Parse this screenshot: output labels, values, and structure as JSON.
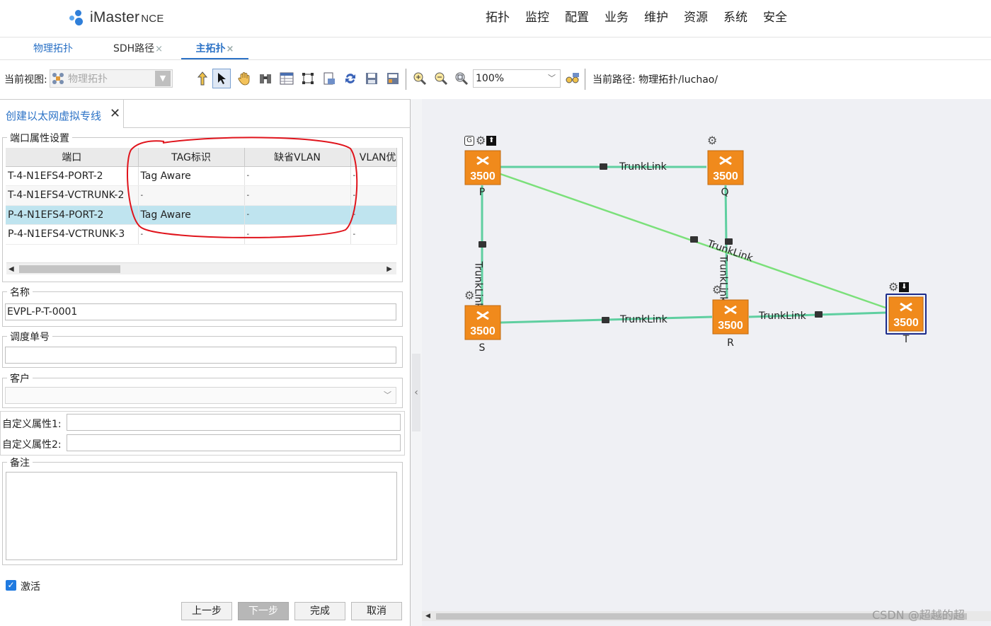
{
  "header": {
    "logo_text": "iMaster",
    "logo_suffix": "NCE",
    "menu": [
      "拓扑",
      "监控",
      "配置",
      "业务",
      "维护",
      "资源",
      "系统",
      "安全"
    ]
  },
  "tabs": [
    {
      "label": "物理拓扑",
      "closable": false
    },
    {
      "label": "SDH路径",
      "closable": true
    },
    {
      "label": "主拓扑",
      "closable": true
    }
  ],
  "toolbar": {
    "view_label": "当前视图:",
    "view_value": "物理拓扑",
    "zoom_value": "100%",
    "path_label": "当前路径: 物理拓扑/luchao/"
  },
  "panel": {
    "tab_title": "创建以太网虚拟专线",
    "port_section_title": "端口属性设置",
    "columns": [
      "端口",
      "TAG标识",
      "缺省VLAN",
      "VLAN优"
    ],
    "rows": [
      [
        "T-4-N1EFS4-PORT-2",
        "Tag Aware",
        "-",
        "-"
      ],
      [
        "T-4-N1EFS4-VCTRUNK-2",
        "-",
        "-",
        "-"
      ],
      [
        "P-4-N1EFS4-PORT-2",
        "Tag Aware",
        "-",
        "-"
      ],
      [
        "P-4-N1EFS4-VCTRUNK-3",
        "-",
        "-",
        "-"
      ]
    ],
    "selected_row": 2,
    "name_label": "名称",
    "name_value": "EVPL-P-T-0001",
    "dispatch_label": "调度单号",
    "dispatch_value": "",
    "customer_label": "客户",
    "custom1_label": "自定义属性1:",
    "custom2_label": "自定义属性2:",
    "remark_label": "备注",
    "activate_label": "激活",
    "activate_checked": true,
    "buttons": {
      "prev": "上一步",
      "next": "下一步",
      "finish": "完成",
      "cancel": "取消"
    }
  },
  "topology": {
    "nodes": [
      {
        "id": "P",
        "model": "3500"
      },
      {
        "id": "Q",
        "model": "3500"
      },
      {
        "id": "S",
        "model": "3500"
      },
      {
        "id": "R",
        "model": "3500"
      },
      {
        "id": "T",
        "model": "3500"
      }
    ],
    "link_label": "TrunkLink",
    "link_color": "#5fcfa0",
    "highlight_link_color": "#7be07a",
    "node_color": "#f08a1c"
  },
  "watermark": "CSDN @超越的超"
}
